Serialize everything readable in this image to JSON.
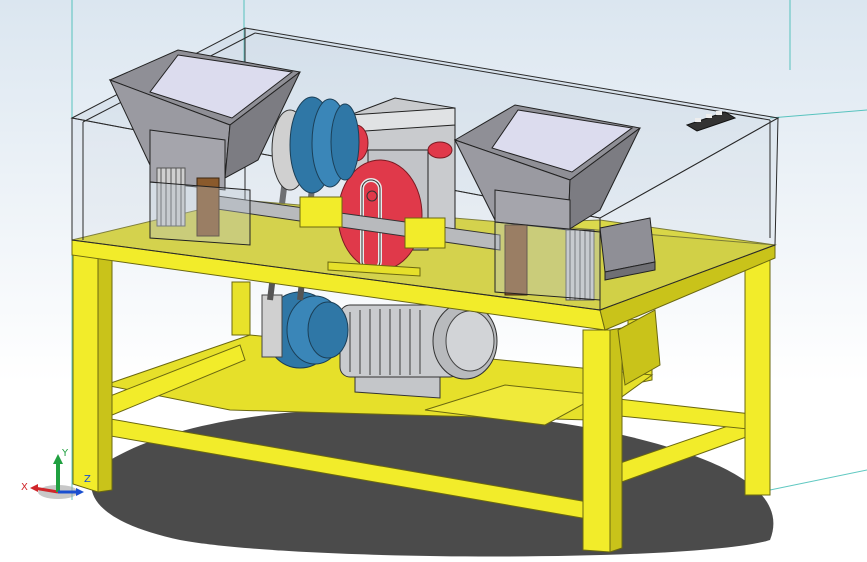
{
  "viewport": {
    "background_top": "#dbe6f0",
    "background_bottom": "#ffffff"
  },
  "colors": {
    "frame_yellow": "#f2ec2a",
    "frame_yellow_dark": "#b3ad12",
    "tabletop": "#d8d224",
    "enclosure_stroke": "#2a2a2a",
    "hopper_gray": "#8f8f96",
    "hopper_inner": "#dcdcee",
    "pulley_blue": "#2f77a6",
    "gear_red": "#e0394a",
    "motor_gray": "#c9cbce",
    "shaft_gray": "#b8babd",
    "shadow": "#2c2c2c",
    "guide_line": "#1db2a8"
  },
  "triad": {
    "x_label": "X",
    "y_label": "Y",
    "z_label": "Z",
    "x_color": "#d0262a",
    "y_color": "#20a040",
    "z_color": "#1a4fd0"
  }
}
